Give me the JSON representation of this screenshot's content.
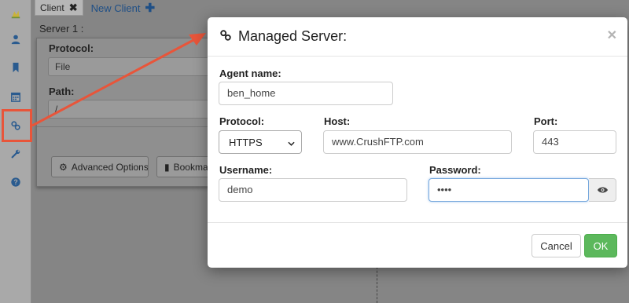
{
  "app": {
    "tabs": [
      {
        "label": "Client"
      },
      {
        "label": "New Client"
      }
    ],
    "server_label": "Server 1 :"
  },
  "background_form": {
    "protocol_label": "Protocol:",
    "protocol_value": "File",
    "path_label": "Path:",
    "path_value": "/",
    "advanced_options_label": "Advanced Options",
    "bookmark_label": "Bookma"
  },
  "sidebar": {
    "items": [
      {
        "icon": "logo-icon"
      },
      {
        "icon": "user-icon"
      },
      {
        "icon": "bookmark-icon"
      },
      {
        "icon": "calendar-icon"
      },
      {
        "icon": "link-icon",
        "highlighted": true
      },
      {
        "icon": "wrench-icon"
      },
      {
        "icon": "question-icon"
      }
    ]
  },
  "modal": {
    "title": "Managed Server:",
    "agent_name_label": "Agent name:",
    "agent_name_value": "ben_home",
    "protocol_label": "Protocol:",
    "protocol_value": "HTTPS",
    "host_label": "Host:",
    "host_value": "www.CrushFTP.com",
    "port_label": "Port:",
    "port_value": "443",
    "username_label": "Username:",
    "username_value": "demo",
    "password_label": "Password:",
    "password_value": "••••",
    "cancel_label": "Cancel",
    "ok_label": "OK"
  },
  "colors": {
    "annotation": "#e8553a",
    "ok_button": "#5cb85c",
    "tab_link": "#1e4f86"
  }
}
